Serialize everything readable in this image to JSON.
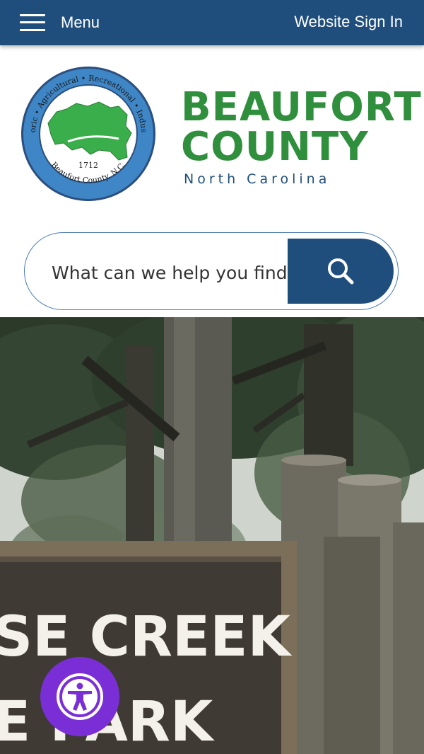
{
  "topbar": {
    "menu_label": "Menu",
    "signin_label": "Website Sign In",
    "background": "#1f4e7d"
  },
  "seal": {
    "ring_text_top": "Historic • Agricultural • Recreational • Industrial",
    "year": "1712",
    "ring_text_bottom": "Beaufort County, N.C."
  },
  "brand": {
    "line1": "BEAUFORT",
    "line2": "COUNTY",
    "subtitle": "North Carolina",
    "color": "#2f8f3c"
  },
  "search": {
    "placeholder": "What can we help you find?"
  },
  "hero": {
    "sign_line1": "SE CREEK",
    "sign_line2": "E PARK"
  },
  "accessibility": {
    "icon": "accessibility-icon",
    "color": "#7a2fd6"
  }
}
